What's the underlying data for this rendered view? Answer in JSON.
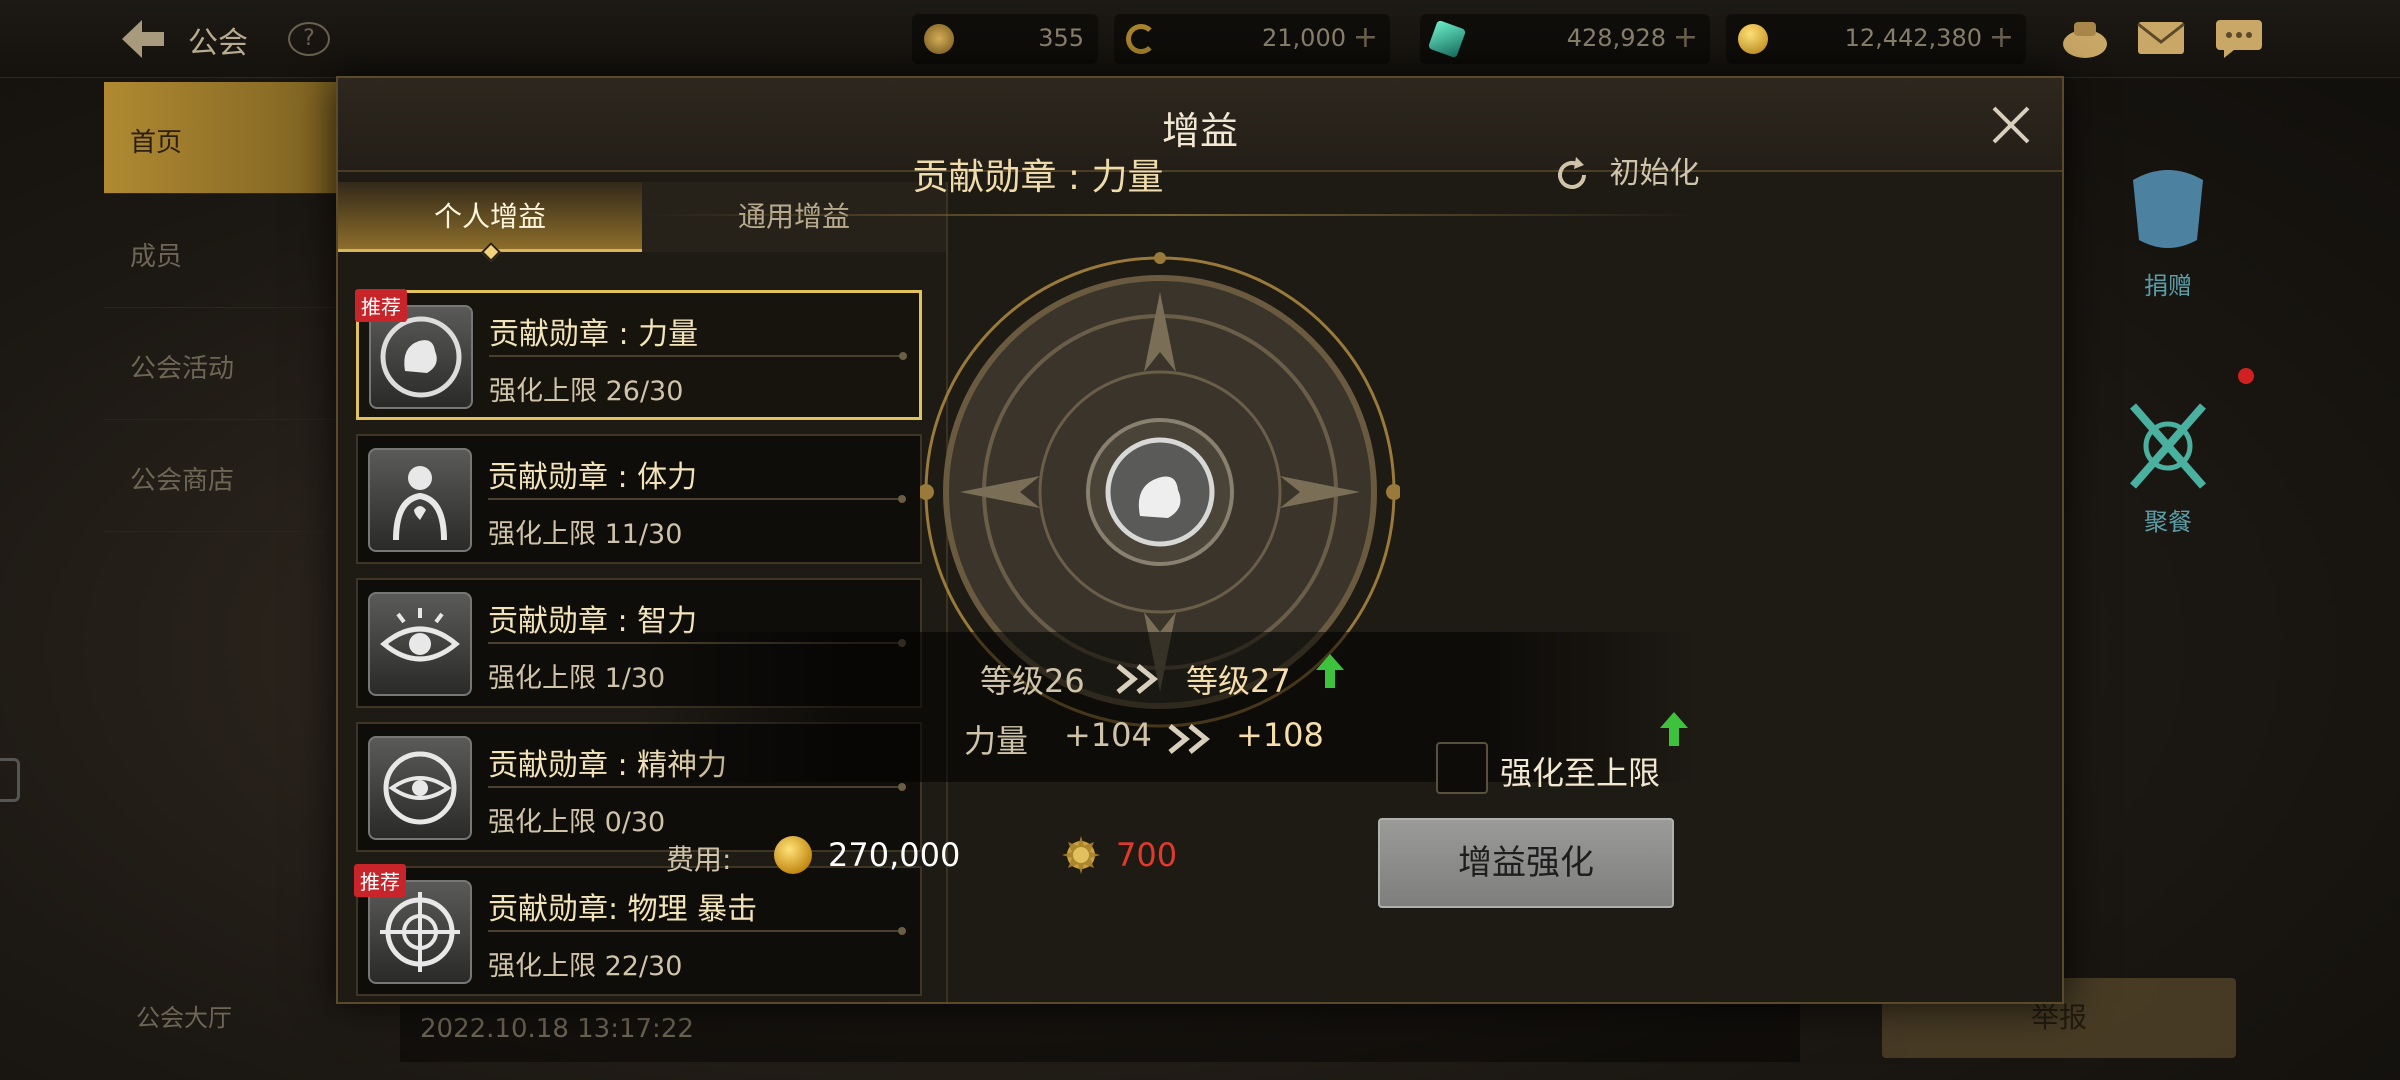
{
  "top_bar": {
    "title": "公会",
    "resources": [
      {
        "icon": "stamina-icon",
        "value": "355",
        "color": "#c59a3d",
        "plus": false
      },
      {
        "icon": "crescent-coin-icon",
        "value": "21,000",
        "color": "#b9902a",
        "plus": true
      },
      {
        "icon": "green-gem-icon",
        "value": "428,928",
        "color": "#3fc39a",
        "plus": true
      },
      {
        "icon": "gold-coin-icon",
        "value": "12,442,380",
        "color": "#d9a524",
        "plus": true
      }
    ]
  },
  "background": {
    "nav": [
      "首页",
      "成员",
      "公会活动",
      "公会商店"
    ],
    "hall_label": "公会大厅",
    "timestamp": "2022.10.18 13:17:22",
    "side_icons": [
      {
        "label": "捐赠",
        "name": "donate"
      },
      {
        "label": "聚餐",
        "name": "feast"
      }
    ],
    "right_button": "举报"
  },
  "modal": {
    "title": "增益",
    "tabs": [
      "个人增益",
      "通用增益"
    ],
    "buffs": [
      {
        "name": "贡献勋章 : 力量",
        "cap": "强化上限 26/30",
        "badge": "推荐",
        "icon": "strength-arm-icon"
      },
      {
        "name": "贡献勋章 : 体力",
        "cap": "强化上限 11/30",
        "badge": "",
        "icon": "stamina-heart-icon"
      },
      {
        "name": "贡献勋章 : 智力",
        "cap": "强化上限 1/30",
        "badge": "",
        "icon": "intellect-eye-icon"
      },
      {
        "name": "贡献勋章 : 精神力",
        "cap": "强化上限 0/30",
        "badge": "",
        "icon": "spirit-orb-icon"
      },
      {
        "name": "贡献勋章:  物理 暴击",
        "cap": "强化上限 22/30",
        "badge": "推荐",
        "icon": "crosshair-icon"
      }
    ],
    "detail": {
      "title": "贡献勋章 : 力量",
      "reset_label": "初始化",
      "level_from": "等级26",
      "level_to": "等级27",
      "stat_name": "力量",
      "stat_from": "+104",
      "stat_to": "+108",
      "max_label": "强化至上限",
      "cost_label": "费用:",
      "cost_gold": "270,000",
      "cost_medal": "700",
      "enhance_button": "增益强化"
    }
  }
}
